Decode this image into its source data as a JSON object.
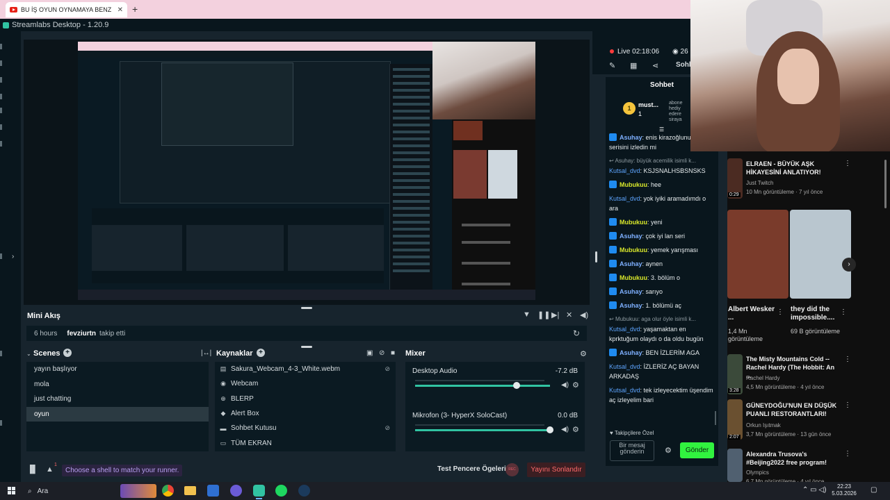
{
  "browser": {
    "tab_title": "BU İŞ OYUN OYNAMAYA BENZ",
    "new_tab": "+"
  },
  "app": {
    "title": "Streamlabs Desktop - 1.20.9"
  },
  "mini_akis": {
    "title": "Mini Akış",
    "event": {
      "time": "6 hours",
      "user": "fevziurtn",
      "action": "takip etti"
    }
  },
  "scenes": {
    "title": "Scenes",
    "items": [
      "yayın başlıyor",
      "mola",
      "just chatting",
      "oyun"
    ],
    "active_index": 3
  },
  "sources": {
    "title": "Kaynaklar",
    "items": [
      {
        "label": "Sakura_Webcam_4-3_White.webm",
        "icon": "film-icon",
        "hidden": true
      },
      {
        "label": "Webcam",
        "icon": "camera-icon",
        "hidden": false
      },
      {
        "label": "BLERP",
        "icon": "globe-icon",
        "hidden": false
      },
      {
        "label": "Alert Box",
        "icon": "bell-icon",
        "hidden": false
      },
      {
        "label": "Sohbet Kutusu",
        "icon": "chat-icon",
        "hidden": true
      },
      {
        "label": "TÜM EKRAN",
        "icon": "monitor-icon",
        "hidden": false
      }
    ]
  },
  "mixer": {
    "title": "Mixer",
    "channels": [
      {
        "name": "Desktop Audio",
        "db": "-7.2 dB",
        "level": 0.75
      },
      {
        "name": "Mikrofon (3- HyperX SoloCast)",
        "db": "0.0 dB",
        "level": 1.0
      }
    ]
  },
  "status_bar": {
    "notif_count": "1",
    "shell_tip": "Choose a shell to match your runner.",
    "test_label": "Test Pencere Ögeleri",
    "rec_label": "REC",
    "end_stream_label": "Yayını Sonlandır"
  },
  "live": {
    "label": "Live",
    "time": "02:18:06",
    "viewers": "26",
    "tab": "Sohb"
  },
  "chat": {
    "title": "Sohbet",
    "top_user": {
      "name": "must...",
      "rank": "1",
      "side_lines": [
        "abone",
        "hediy",
        "edere",
        "siraya"
      ]
    },
    "messages": [
      {
        "user": "Asuhay",
        "kind": "a",
        "text": "enis kirazoğlunun yemek serisini izledin mi"
      },
      {
        "kind": "reply",
        "text": "Asuhay: büyük acemilik isimli k..."
      },
      {
        "user": "Kutsal_dvd",
        "kind": "k",
        "text": "KSJSNALHSBSNSKS"
      },
      {
        "user": "Mubukuu",
        "kind": "m",
        "text": "hee"
      },
      {
        "user": "Kutsal_dvd",
        "kind": "k",
        "text": "yok iyiki aramadımdı o ara"
      },
      {
        "user": "Mubukuu",
        "kind": "m",
        "text": "yeni"
      },
      {
        "user": "Asuhay",
        "kind": "a",
        "text": "çok iyi lan seri"
      },
      {
        "user": "Mubukuu",
        "kind": "m",
        "text": "yemek yarışması"
      },
      {
        "user": "Asuhay",
        "kind": "a",
        "text": "aynen"
      },
      {
        "user": "Mubukuu",
        "kind": "m",
        "text": "3. bölüm o"
      },
      {
        "user": "Asuhay",
        "kind": "a",
        "text": "sarıyo"
      },
      {
        "user": "Asuhay",
        "kind": "a",
        "text": "1. bölümü aç"
      },
      {
        "kind": "reply",
        "text": "Mubukuu: aga olur öyle isimli k..."
      },
      {
        "user": "Kutsal_dvd",
        "kind": "k",
        "text": "yaşamaktan en kprktuğum olaydı o da oldu bugün"
      },
      {
        "user": "Asuhay",
        "kind": "a",
        "text": "BEN İZLERİM AGA"
      },
      {
        "user": "Kutsal_dvd",
        "kind": "k",
        "text": "İZLERİZ AÇ BAYAN ARKADAŞ"
      },
      {
        "user": "Kutsal_dvd",
        "kind": "k",
        "text": "tek izleyecektim üşendim aç izleyelim bari"
      }
    ],
    "follower_note": "Takipçilere Özel",
    "input_placeholder": "Bir mesaj gönderin",
    "send_label": "Gönder"
  },
  "youtube": {
    "videos": [
      {
        "title": "ELRAEN - BÜYÜK AŞK HİKAYESİNİ ANLATIYOR!",
        "channel": "Just Twitch",
        "meta": "10 Mn görüntüleme · 7 yıl önce",
        "duration": "0:29"
      },
      {
        "title": "Albert Wesker ...",
        "meta": "1,4 Mn görüntüleme"
      },
      {
        "title": "they did the impossible....",
        "meta": "69 B görüntüleme"
      },
      {
        "title": "The Misty Mountains Cold -- Rachel Hardy (The Hobbit: An ...",
        "channel": "Rachel Hardy",
        "meta": "4,5 Mn görüntüleme · 4 yıl önce",
        "duration": "3:28"
      },
      {
        "title": "GÜNEYDOĞU'NUN EN DÜŞÜK PUANLI RESTORANTLARI!",
        "channel": "Orkun Işıtmak",
        "meta": "3,7 Mn görüntüleme · 13 gün önce",
        "duration": "2:07"
      },
      {
        "title": "Alexandra Trusova's #Beijing2022 free program!",
        "channel": "Olympics",
        "meta": "6,7 Mn görüntüleme · 4 yıl önce"
      }
    ]
  },
  "taskbar": {
    "search": "Ara",
    "time": "22:23",
    "date": "5.03.2026"
  }
}
